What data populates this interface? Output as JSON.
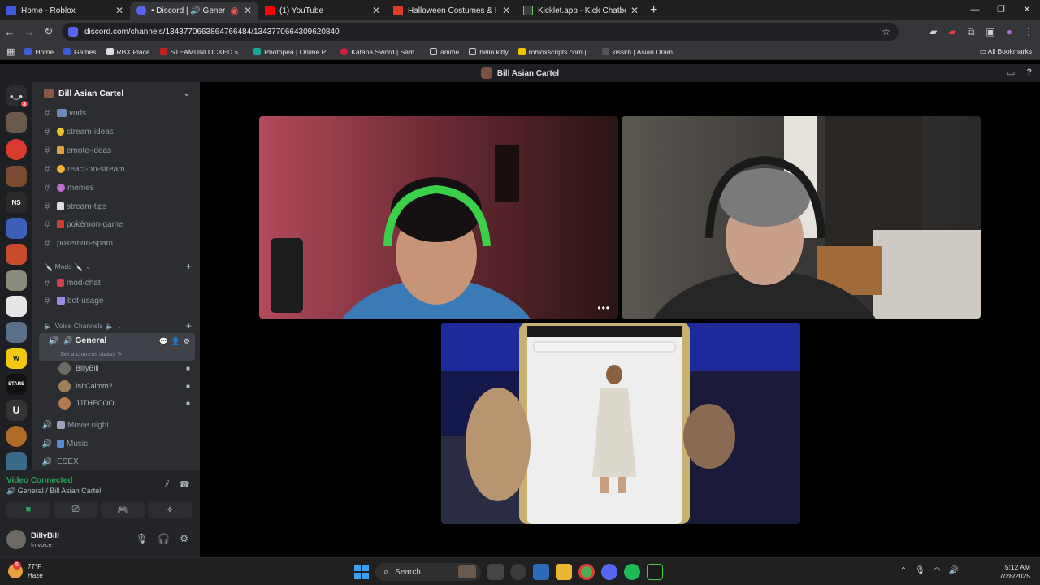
{
  "browser": {
    "tabs": [
      {
        "title": "Home - Roblox",
        "color": "#3b5bdb",
        "active": false
      },
      {
        "title": "• Discord | 🔊 General | Bill",
        "color": "#5865f2",
        "active": true
      },
      {
        "title": "(1) YouTube",
        "color": "#ff0000",
        "active": false
      },
      {
        "title": "Halloween Costumes & Ideas fo",
        "color": "#e03a28",
        "active": false
      },
      {
        "title": "Kicklet.app - Kick Chatbot and C",
        "color": "#3a3a3a",
        "active": false
      }
    ],
    "url": "discord.com/channels/1343770663864766484/1343770664309620840",
    "bookmarks": [
      "Home",
      "Games",
      "RBX.Place",
      "STEAMUNLOCKED »...",
      "Photopea | Online P...",
      "Katana Sword | Sam...",
      "anime",
      "hello kitty",
      "robloxscripts.com |...",
      "kisskh | Asian Dram..."
    ],
    "all_bookmarks": "All Bookmarks"
  },
  "discord": {
    "title": "Bill Asian Cartel",
    "server_name": "Bill Asian Cartel",
    "guild_labels": {
      "ns": "NS",
      "stars": "STARS",
      "u": "U"
    },
    "dm_badge": "3",
    "text_channels": [
      "vods",
      "stream-ideas",
      "emote-ideas",
      "react-on-stream",
      "memes",
      "stream-tips",
      "pokémon-game",
      "pokemon-spam"
    ],
    "mods_category": "Mods",
    "mods_channels": [
      "mod-chat",
      "bot-usage"
    ],
    "voice_category": "Voice Channels",
    "voice_general": {
      "name": "General",
      "status": "Set a channel status"
    },
    "voice_users": [
      "BillyBill",
      "IsItCalmm?",
      "JJTHECOOL"
    ],
    "other_voice": [
      "Movie night",
      "Music",
      "ESEX"
    ],
    "voice_panel": {
      "status": "Video Connected",
      "channel": "General / Bill Asian Cartel"
    },
    "user": {
      "name": "BillyBill",
      "status": "In voice"
    }
  },
  "taskbar": {
    "temp": "77°F",
    "weather": "Haze",
    "weather_badge": "5",
    "search": "Search",
    "time": "5:12 AM",
    "date": "7/28/2025"
  }
}
